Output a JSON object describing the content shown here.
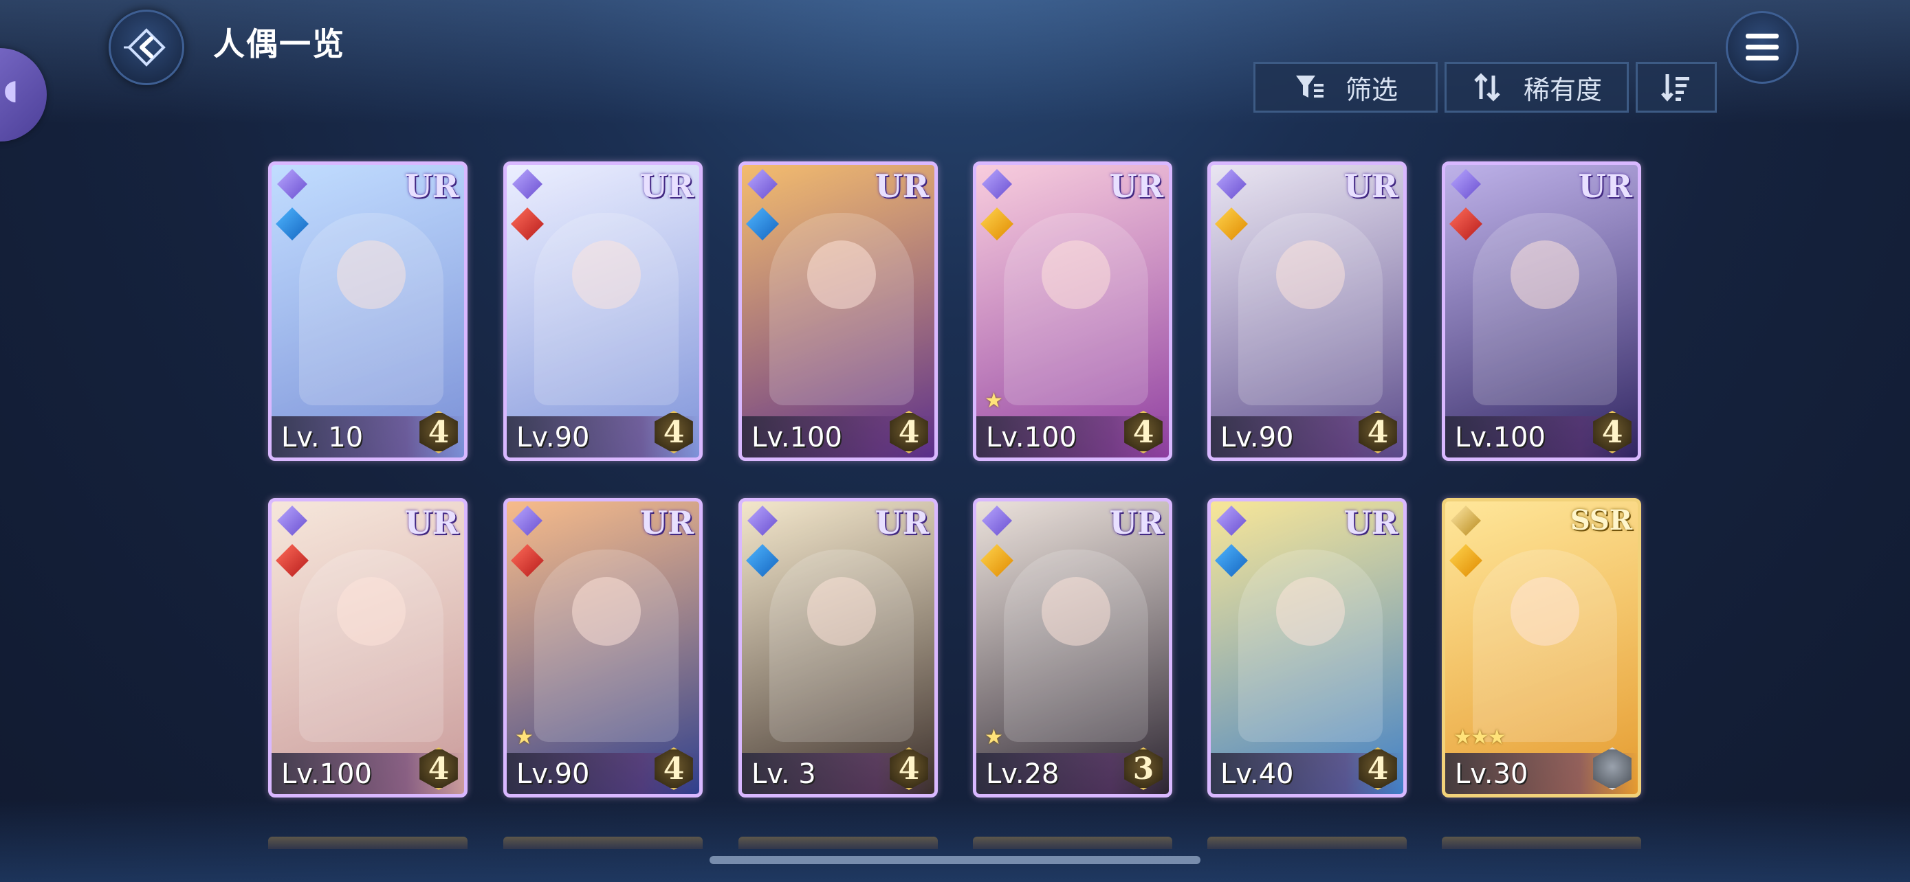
{
  "header": {
    "title": "人偶一览",
    "back_icon": "back-arrow-icon",
    "menu_icon": "hamburger-menu-icon"
  },
  "toolbar": {
    "filter_label": "筛选",
    "rarity_label": "稀有度",
    "filter_icon": "filter-icon",
    "sort_icon": "sort-arrows-icon",
    "order_icon": "sort-order-icon"
  },
  "colors": {
    "background": "#15223d",
    "accent": "#3e5f93",
    "ur_frame": "#d9b8ff",
    "ssr_frame": "#f2d27a"
  },
  "cards": [
    {
      "rarity": "UR",
      "level": "Lv. 10",
      "limit": "4",
      "element": "water",
      "stars": "",
      "bg": [
        "#b9d8ff",
        "#7a8fd6"
      ]
    },
    {
      "rarity": "UR",
      "level": "Lv.90",
      "limit": "4",
      "element": "fire",
      "stars": "",
      "bg": [
        "#e9ecff",
        "#7e93d9"
      ]
    },
    {
      "rarity": "UR",
      "level": "Lv.100",
      "limit": "4",
      "element": "water",
      "stars": "",
      "bg": [
        "#f2b35a",
        "#5a2e8c"
      ]
    },
    {
      "rarity": "UR",
      "level": "Lv.100",
      "limit": "4",
      "element": "light",
      "stars": "★",
      "bg": [
        "#f7c6d8",
        "#8e3ea0"
      ]
    },
    {
      "rarity": "UR",
      "level": "Lv.90",
      "limit": "4",
      "element": "light",
      "stars": "",
      "bg": [
        "#e7e2f0",
        "#5a4a8a"
      ]
    },
    {
      "rarity": "UR",
      "level": "Lv.100",
      "limit": "4",
      "element": "fire",
      "stars": "",
      "bg": [
        "#b5a7e6",
        "#2f2460"
      ]
    },
    {
      "rarity": "UR",
      "level": "Lv.100",
      "limit": "4",
      "element": "fire",
      "stars": "",
      "bg": [
        "#f5e3d6",
        "#c99a9a"
      ]
    },
    {
      "rarity": "UR",
      "level": "Lv.90",
      "limit": "4",
      "element": "fire",
      "stars": "★",
      "bg": [
        "#f6b27a",
        "#2e3f8e"
      ]
    },
    {
      "rarity": "UR",
      "level": "Lv. 3",
      "limit": "4",
      "element": "water",
      "stars": "",
      "bg": [
        "#f1e3c4",
        "#3a2e2a"
      ]
    },
    {
      "rarity": "UR",
      "level": "Lv.28",
      "limit": "3",
      "element": "light",
      "stars": "★",
      "bg": [
        "#e8ddd6",
        "#2b2430"
      ]
    },
    {
      "rarity": "UR",
      "level": "Lv.40",
      "limit": "4",
      "element": "water",
      "stars": "",
      "bg": [
        "#f7e38a",
        "#3f7fc8"
      ]
    },
    {
      "rarity": "SSR",
      "level": "Lv.30",
      "limit": "",
      "element": "light",
      "stars": "★★★",
      "bg": [
        "#ffe38c",
        "#e59a2e"
      ]
    }
  ]
}
